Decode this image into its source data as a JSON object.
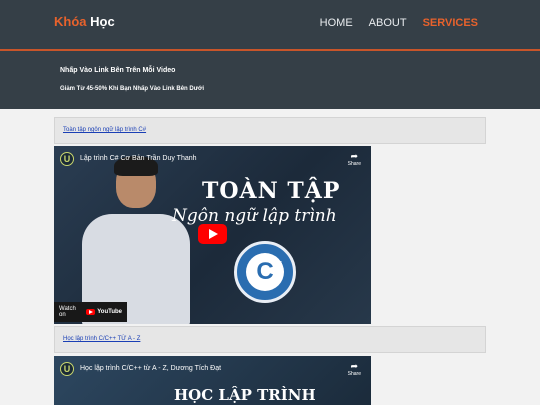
{
  "header": {
    "logo_part1": "Khóa",
    "logo_part2": "Học",
    "nav": [
      "HOME",
      "ABOUT",
      "SERVICES"
    ],
    "active_nav": "SERVICES",
    "accent_color": "#e8622c"
  },
  "banner": {
    "line1": "Nhấp Vào Link Bên Trên Mỗi Video",
    "line2": "Giảm Từ 45-50% Khi Bạn Nhấp Vào Link Bên Dưới"
  },
  "sections": [
    {
      "link": "Toàn tập ngôn ngữ lập trình C#",
      "video": {
        "channel_icon": "U",
        "title": "Lập trình C# Cơ Bản Trần Duy Thanh",
        "share_label": "Share",
        "thumb_line1": "TOÀN TẬP",
        "thumb_line2": "Ngôn ngữ lập trình",
        "badge": "C",
        "badge_hash": "#",
        "watch_label": "Watch on",
        "youtube_label": "YouTube"
      }
    },
    {
      "link": "Học lập trình C/C++ TỪ A - Z",
      "video": {
        "channel_icon": "U",
        "title": "Học lập trình C/C++ từ A - Z, Dương Tích Đạt",
        "share_label": "Share",
        "thumb_line1": "HỌC LẬP TRÌNH C/C++"
      }
    }
  ]
}
